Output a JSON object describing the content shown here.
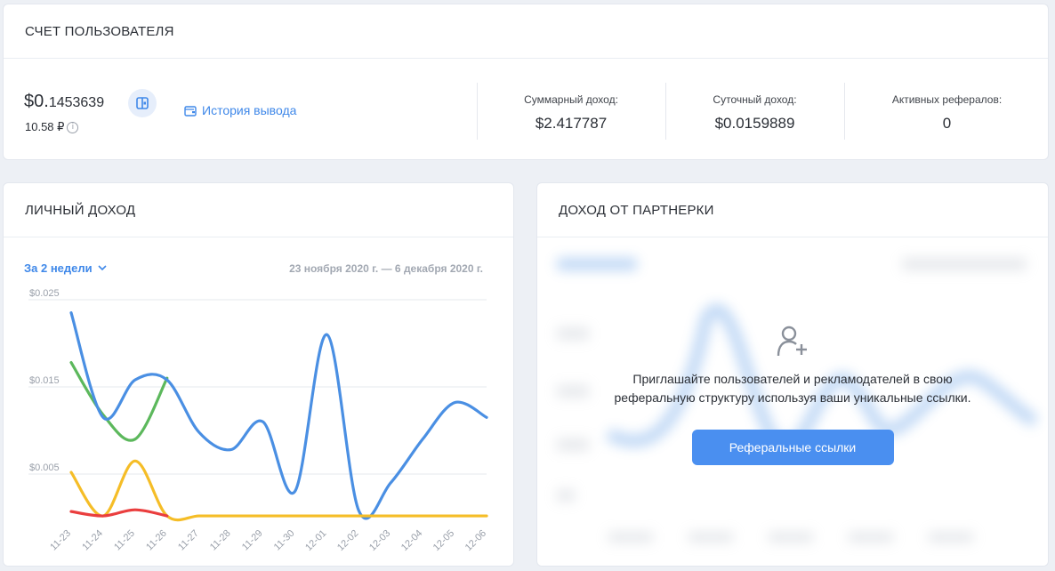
{
  "account": {
    "title": "СЧЕТ ПОЛЬЗОВАТЕЛЯ",
    "balance_main": "$0.",
    "balance_decimals": "1453639",
    "balance_rub": "10.58 ₽",
    "info_glyph": "i",
    "history_label": "История вывода",
    "stats": [
      {
        "label": "Суммарный доход:",
        "value": "$2.417787"
      },
      {
        "label": "Суточный доход:",
        "value": "$0.0159889"
      },
      {
        "label": "Активных рефералов:",
        "value": "0"
      }
    ]
  },
  "personal": {
    "title": "ЛИЧНЫЙ ДОХОД",
    "period_label": "За 2 недели",
    "date_range": "23 ноября 2020 г. — 6 декабря 2020 г."
  },
  "partner": {
    "title": "ДОХОД ОТ ПАРТНЕРКИ",
    "invite_text": "Приглашайте пользователей и рекламодателей в свою реферальную структуру используя ваши уникальные ссылки.",
    "button_label": "Реферальные ссылки"
  },
  "colors": {
    "accent": "#3f88e9",
    "blue": "#4a8fe3",
    "green": "#5cb85c",
    "yellow": "#f5bd27",
    "red": "#ea3e3e"
  },
  "chart_data": {
    "type": "line",
    "categories": [
      "11-23",
      "11-24",
      "11-25",
      "11-26",
      "11-27",
      "11-28",
      "11-29",
      "11-30",
      "12-01",
      "12-02",
      "12-03",
      "12-04",
      "12-05",
      "12-06"
    ],
    "y_tick_labels": [
      "$0.025",
      "$0.015",
      "$0.005"
    ],
    "y_tick_values": [
      0.025,
      0.015,
      0.005
    ],
    "ylim": [
      0,
      0.025
    ],
    "grid": true,
    "series": [
      {
        "color": "#5cb85c",
        "values": [
          0.0178,
          0.0118,
          0.009,
          0.016,
          null,
          null,
          null,
          null,
          null,
          null,
          null,
          null,
          null,
          null
        ]
      },
      {
        "color": "#4a8fe3",
        "values": [
          0.0235,
          0.0115,
          0.0158,
          0.0158,
          0.0098,
          0.0078,
          0.011,
          0.003,
          0.021,
          0.0008,
          0.004,
          0.009,
          0.0132,
          0.0115
        ]
      },
      {
        "color": "#f5bd27",
        "values": [
          0.0052,
          0.0002,
          0.0065,
          0.0002,
          0.0002,
          0.0002,
          0.0002,
          0.0002,
          0.0002,
          0.0002,
          0.0002,
          0.0002,
          0.0002,
          0.0002
        ]
      },
      {
        "color": "#ea3e3e",
        "values": [
          0.0007,
          0.0002,
          0.0009,
          0.0002,
          null,
          null,
          null,
          null,
          null,
          null,
          null,
          null,
          null,
          null
        ]
      }
    ]
  }
}
